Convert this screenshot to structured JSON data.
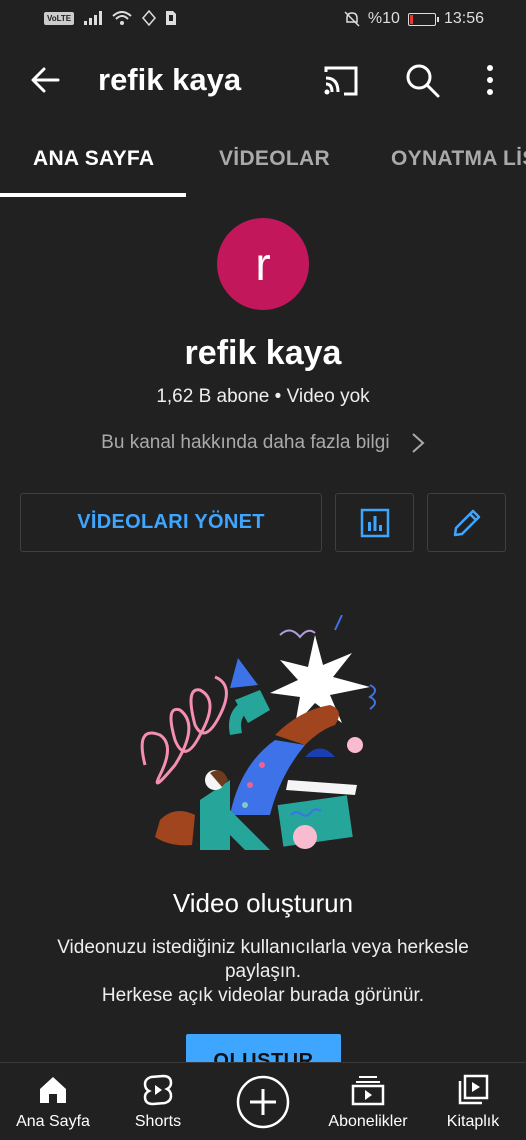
{
  "status_bar": {
    "volte": "VoLTE",
    "battery_text": "%10",
    "time": "13:56"
  },
  "app_bar": {
    "title": "refik kaya",
    "icons": [
      "back-arrow-icon",
      "cast-icon",
      "search-icon",
      "more-vert-icon"
    ]
  },
  "tabs": [
    {
      "label": "ANA SAYFA",
      "active": true
    },
    {
      "label": "VİDEOLAR",
      "active": false
    },
    {
      "label": "OYNATMA LİSTELERİ",
      "active": false
    }
  ],
  "channel": {
    "avatar_letter": "r",
    "avatar_color": "#c2185b",
    "name": "refik kaya",
    "meta": "1,62 B abone • Video yok",
    "about": "Bu kanal hakkında daha fazla bilgi"
  },
  "actions": {
    "manage_videos": "VİDEOLARI YÖNET",
    "accent_color": "#3ea6ff"
  },
  "empty_state": {
    "title": "Video oluşturun",
    "description_line1": "Videonuzu istediğiniz kullanıcılarla veya herkesle paylaşın.",
    "description_line2": "Herkese açık videolar burada görünür.",
    "create_button": "OLUŞTUR"
  },
  "bottom_nav": {
    "home": "Ana Sayfa",
    "shorts": "Shorts",
    "subscriptions": "Abonelikler",
    "library": "Kitaplık"
  }
}
